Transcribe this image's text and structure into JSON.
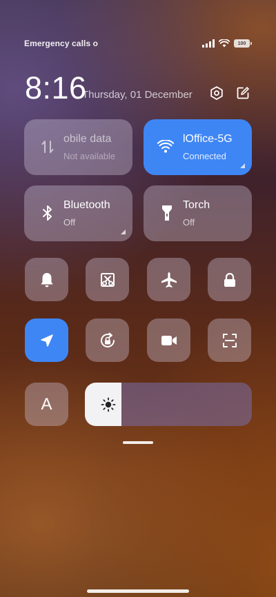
{
  "status_bar": {
    "carrier_text": "Emergency calls o",
    "battery_level": "100",
    "icons": [
      "signal-icon",
      "wifi-icon",
      "battery-icon"
    ]
  },
  "header": {
    "time": "8:16",
    "date": "Thursday, 01 December",
    "icons": [
      "settings-icon",
      "edit-icon"
    ]
  },
  "tiles": {
    "mobile_data": {
      "title": "obile data",
      "subtitle": "Not available",
      "icon": "mobile-data-icon",
      "active": false
    },
    "wifi": {
      "title": "lOffice-5G",
      "subtitle": "Connected",
      "icon": "wifi-icon",
      "active": true
    },
    "bluetooth": {
      "title": "Bluetooth",
      "subtitle": "Off",
      "icon": "bluetooth-icon",
      "active": false
    },
    "torch": {
      "title": "Torch",
      "subtitle": "Off",
      "icon": "torch-icon",
      "active": false
    }
  },
  "toggles": [
    {
      "name": "bell-icon",
      "active": false
    },
    {
      "name": "screenshot-icon",
      "active": false
    },
    {
      "name": "airplane-icon",
      "active": false
    },
    {
      "name": "lock-icon",
      "active": false
    },
    {
      "name": "location-icon",
      "active": true
    },
    {
      "name": "rotation-lock-icon",
      "active": false
    },
    {
      "name": "video-icon",
      "active": false
    },
    {
      "name": "scan-icon",
      "active": false
    }
  ],
  "brightness": {
    "auto_label": "A",
    "level_fraction": 0.22,
    "icon": "sun-icon"
  },
  "colors": {
    "accent": "#3f86f5",
    "tile_bg": "rgba(205,195,215,0.38)"
  }
}
